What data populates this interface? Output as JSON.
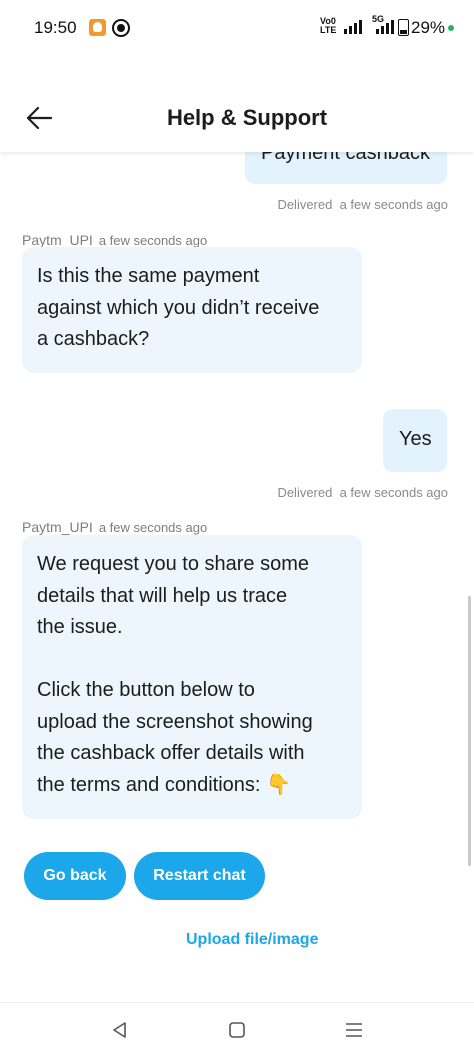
{
  "status_bar": {
    "time": "19:50",
    "volte": "Vo0 LTE",
    "network": "5G",
    "battery_percent": "29%",
    "icons": [
      "app-notification-icon",
      "messenger-icon",
      "signal-icon",
      "battery-icon"
    ]
  },
  "header": {
    "title": "Help & Support",
    "back_icon": "arrow-left-icon"
  },
  "messages": {
    "prev_user_partial": "Payment cashback",
    "delivered_1": {
      "status": "Delivered",
      "time": "a few seconds ago"
    },
    "bot_1": {
      "sender": "Paytm_UPI",
      "time": "a few seconds ago",
      "text": "Is this the same payment\nagainst which you didn’t receive\na cashback?"
    },
    "user_1": "Yes",
    "delivered_2": {
      "status": "Delivered",
      "time": "a few seconds ago"
    },
    "bot_2": {
      "sender": "Paytm_UPI",
      "time": "a few seconds ago",
      "text": "We request you to share some\ndetails that will help us trace\nthe issue.\n\nClick the button below to\nupload the screenshot showing\nthe cashback offer details with\nthe terms and conditions: 👇"
    }
  },
  "actions": {
    "go_back": "Go back",
    "restart_chat": "Restart chat",
    "upload": "Upload file/image"
  },
  "colors": {
    "accent": "#1ba7ea",
    "user_bubble": "#e3f3fd",
    "bot_bubble": "#eef6fd"
  },
  "nav_bar": {
    "icons": [
      "back-triangle-icon",
      "home-square-icon",
      "menu-lines-icon"
    ]
  }
}
